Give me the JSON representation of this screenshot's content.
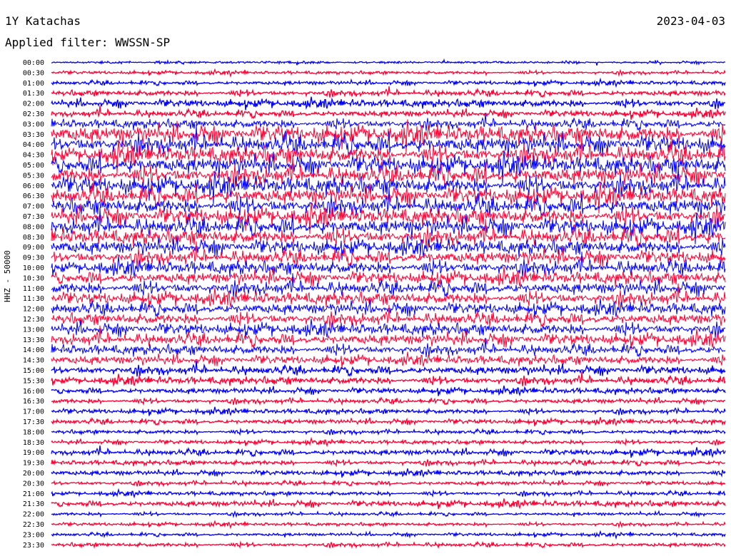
{
  "header": {
    "station": "1Y Katachas",
    "date": "2023-04-03",
    "filter": "Applied filter: WWSSN-SP"
  },
  "chart_data": {
    "type": "line",
    "title": "1Y Katachas",
    "ylabel": "HHZ - 50000",
    "colors": [
      "#0000ff",
      "#ff0033"
    ],
    "row_labels": [
      "00:00",
      "00:30",
      "01:00",
      "01:30",
      "02:00",
      "02:30",
      "03:00",
      "03:30",
      "04:00",
      "04:30",
      "05:00",
      "05:30",
      "06:00",
      "06:30",
      "07:00",
      "07:30",
      "08:00",
      "08:30",
      "09:00",
      "09:30",
      "10:00",
      "10:30",
      "11:00",
      "11:30",
      "12:00",
      "12:30",
      "13:00",
      "13:30",
      "14:00",
      "14:30",
      "15:00",
      "15:30",
      "16:00",
      "16:30",
      "17:00",
      "17:30",
      "18:00",
      "18:30",
      "19:00",
      "19:30",
      "20:00",
      "20:30",
      "21:00",
      "21:30",
      "22:00",
      "22:30",
      "23:00",
      "23:30"
    ],
    "relative_amplitude": [
      0.15,
      0.2,
      0.25,
      0.35,
      0.45,
      0.4,
      0.55,
      1.0,
      1.0,
      1.0,
      1.0,
      1.0,
      1.0,
      0.95,
      0.95,
      0.95,
      0.95,
      0.9,
      0.85,
      0.8,
      0.8,
      0.75,
      0.75,
      0.75,
      0.7,
      0.7,
      0.7,
      0.7,
      0.6,
      0.55,
      0.5,
      0.45,
      0.35,
      0.3,
      0.3,
      0.3,
      0.25,
      0.25,
      0.35,
      0.3,
      0.3,
      0.25,
      0.25,
      0.35,
      0.2,
      0.2,
      0.2,
      0.25
    ]
  }
}
